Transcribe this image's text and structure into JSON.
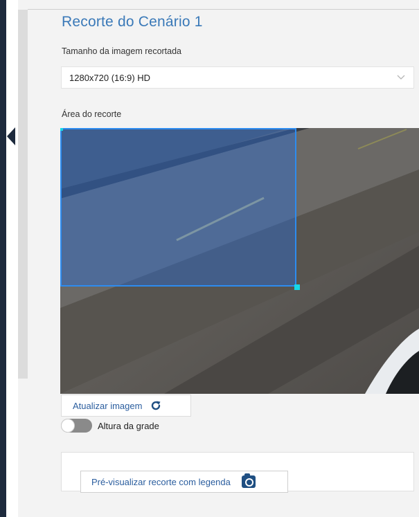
{
  "panel": {
    "title": "Recorte do Cenário 1"
  },
  "image_size": {
    "label": "Tamanho da imagem recortada",
    "selected": "1280x720 (16:9) HD"
  },
  "crop": {
    "label": "Área do recorte",
    "selection_color": "#2d8cf0",
    "handle_color": "#17d9e8"
  },
  "actions": {
    "refresh_label": "Atualizar imagem",
    "refresh_icon": "refresh-icon",
    "grid_toggle_label": "Altura da grade",
    "grid_toggle_on": false,
    "preview_label": "Pré-visualizar recorte com legenda",
    "preview_icon": "camera-icon"
  },
  "colors": {
    "accent": "#3a79b8",
    "sidebar": "#1d2a3d",
    "button_text": "#2a5d9e"
  }
}
